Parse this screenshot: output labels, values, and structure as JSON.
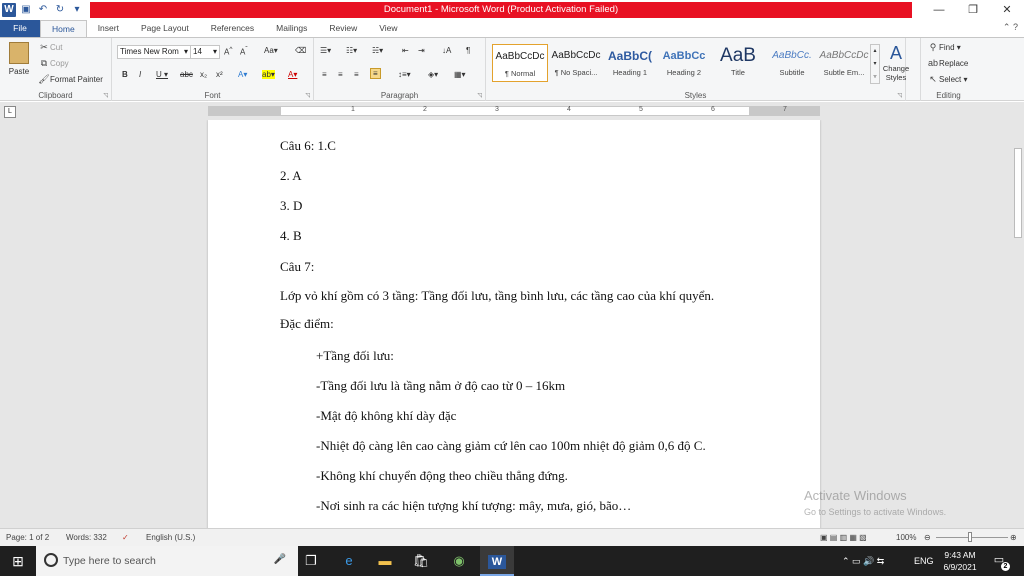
{
  "window": {
    "title": "Document1 - Microsoft Word (Product Activation Failed)",
    "controls": [
      "—",
      "❐",
      "✕"
    ]
  },
  "qat": [
    "W",
    "💾",
    "↶",
    "↻",
    "▾"
  ],
  "tabs": [
    {
      "label": "File"
    },
    {
      "label": "Home"
    },
    {
      "label": "Insert"
    },
    {
      "label": "Page Layout"
    },
    {
      "label": "References"
    },
    {
      "label": "Mailings"
    },
    {
      "label": "Review"
    },
    {
      "label": "View"
    }
  ],
  "clipboard": {
    "paste": "Paste",
    "cut": "Cut",
    "copy": "Copy",
    "format_painter": "Format Painter",
    "label": "Clipboard"
  },
  "font": {
    "name": "Times New Rom",
    "size": "14",
    "label": "Font"
  },
  "paragraph": {
    "label": "Paragraph"
  },
  "styles": {
    "label": "Styles",
    "items": [
      {
        "preview": "AaBbCcDc",
        "name": "¶ Normal"
      },
      {
        "preview": "AaBbCcDc",
        "name": "¶ No Spaci..."
      },
      {
        "preview": "AaBbC(",
        "name": "Heading 1"
      },
      {
        "preview": "AaBbCc",
        "name": "Heading 2"
      },
      {
        "preview": "AaB",
        "name": "Title"
      },
      {
        "preview": "AaBbCc.",
        "name": "Subtitle"
      },
      {
        "preview": "AaBbCcDc",
        "name": "Subtle Em..."
      }
    ],
    "change": "Change Styles"
  },
  "editing": {
    "find": "Find",
    "replace": "Replace",
    "select": "Select",
    "label": "Editing"
  },
  "document": {
    "paragraphs": [
      "Câu 6: 1.C",
      "2. A",
      "3. D",
      "4. B",
      "Câu 7:",
      "Lớp vỏ khí gồm có 3 tầng: Tầng đối lưu, tầng bình lưu, các tầng cao của khí quyển.",
      "Đặc điểm:",
      "+Tầng đối lưu:",
      "-Tầng đối lưu là tầng nằm ở độ cao từ 0 – 16km",
      "-Mật độ không khí dày đặc",
      "-Nhiệt độ càng lên cao càng giảm cứ lên cao 100m nhiệt độ giảm 0,6 độ C.",
      "-Không khí chuyển động theo chiều thẳng đứng.",
      "-Nơi sinh ra các hiện tượng khí tượng: mây, mưa, gió, bão…"
    ]
  },
  "watermark": {
    "line1": "Activate Windows",
    "line2": "Go to Settings to activate Windows."
  },
  "status": {
    "page": "Page: 1 of 2",
    "words": "Words: 332",
    "language": "English (U.S.)",
    "zoom": "100%"
  },
  "taskbar": {
    "search_placeholder": "Type here to search",
    "tray_lang": "ENG",
    "time": "9:43 AM",
    "date": "6/9/2021",
    "notif_count": "2"
  }
}
